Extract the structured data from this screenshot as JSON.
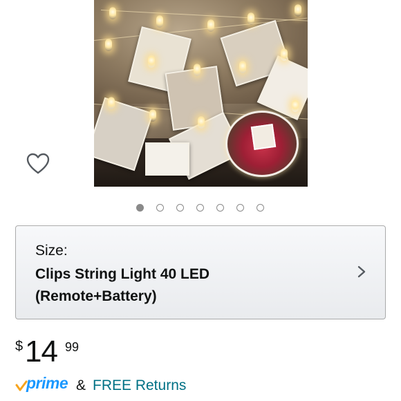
{
  "product_image": {
    "icon": "product-photo-clips-string-light"
  },
  "wishlist": {
    "icon": "heart-outline-icon"
  },
  "carousel": {
    "total": 7,
    "active_index": 0
  },
  "size_selector": {
    "label": "Size:",
    "value_line1": "Clips String Light 40 LED",
    "value_line2": "(Remote+Battery)",
    "icon": "chevron-right-icon"
  },
  "price": {
    "currency_symbol": "$",
    "whole": "14",
    "fraction": "99"
  },
  "shipping": {
    "prime_label": "prime",
    "ampersand": "&",
    "free_returns_label": "FREE Returns",
    "prime_color": "#1a98ff",
    "prime_check_color": "#f7a41d",
    "link_color": "#007185"
  }
}
